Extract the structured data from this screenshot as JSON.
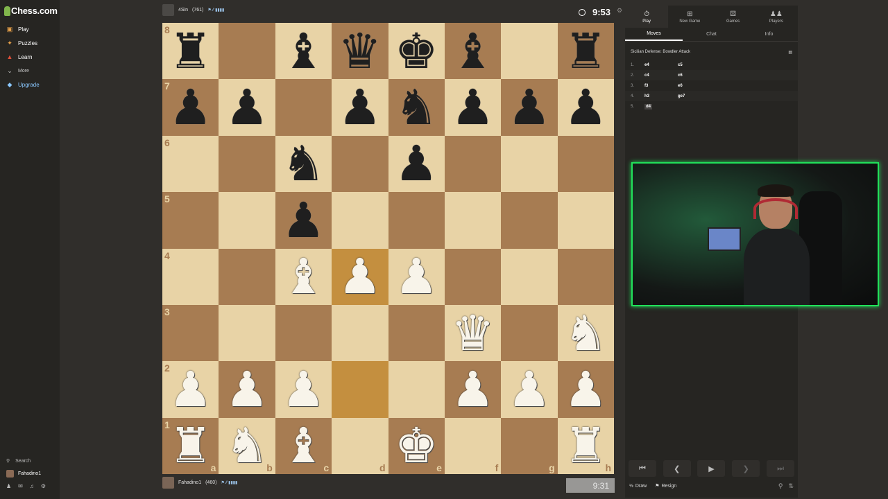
{
  "sidebar": {
    "logo_text": "Chess.com",
    "items": [
      {
        "label": "Play",
        "icon": "play-board-icon",
        "color": "#e8a24a"
      },
      {
        "label": "Puzzles",
        "icon": "puzzle-icon",
        "color": "#e8a24a"
      },
      {
        "label": "Learn",
        "icon": "learn-icon",
        "color": "#e0503a"
      },
      {
        "label": "More",
        "icon": "chevron-down-icon"
      },
      {
        "label": "Upgrade",
        "icon": "diamond-icon",
        "color": "#8ac7ff"
      }
    ],
    "search_label": "Search",
    "username": "Fahadino1"
  },
  "top_player": {
    "name": "4Sin",
    "rating": "(761)"
  },
  "bottom_player": {
    "name": "Fahadino1",
    "rating": "(460)"
  },
  "clocks": {
    "top": "9:53",
    "bottom": "9:31"
  },
  "board": {
    "ranks": [
      "8",
      "7",
      "6",
      "5",
      "4",
      "3",
      "2",
      "1"
    ],
    "files": [
      "a",
      "b",
      "c",
      "d",
      "e",
      "f",
      "g",
      "h"
    ],
    "position": [
      [
        "r",
        "",
        "b",
        "q",
        "k",
        "b",
        "",
        "r"
      ],
      [
        "p",
        "p",
        "",
        "p",
        "n",
        "p",
        "p",
        "p"
      ],
      [
        "",
        "",
        "n",
        "",
        "p",
        "",
        "",
        ""
      ],
      [
        "",
        "",
        "p",
        "",
        "",
        "",
        "",
        ""
      ],
      [
        "",
        "",
        "B",
        "P",
        "P",
        "",
        "",
        ""
      ],
      [
        "",
        "",
        "",
        "",
        "",
        "Q",
        "",
        "N"
      ],
      [
        "P",
        "P",
        "P",
        "",
        "",
        "P",
        "P",
        "P"
      ],
      [
        "R",
        "N",
        "B",
        "",
        "K",
        "",
        "",
        "R"
      ]
    ],
    "highlight": [
      "d4",
      "d2"
    ]
  },
  "panel": {
    "tabs": [
      {
        "label": "Play",
        "icon": "stopwatch-icon"
      },
      {
        "label": "New Game",
        "icon": "plus-icon"
      },
      {
        "label": "Games",
        "icon": "dice-icon"
      },
      {
        "label": "Players",
        "icon": "players-icon"
      }
    ],
    "subtabs": [
      "Moves",
      "Chat",
      "Info"
    ],
    "opening": "Sicilian Defense: Bowdler Attack",
    "moves": [
      {
        "num": "1.",
        "white": "e4",
        "black": "c5"
      },
      {
        "num": "2.",
        "white": "c4",
        "black": "c6"
      },
      {
        "num": "3.",
        "white": "f3",
        "black": "e6"
      },
      {
        "num": "4.",
        "white": "h3",
        "black": "ge7"
      },
      {
        "num": "5.",
        "white": "d4",
        "black": ""
      }
    ],
    "draw_label": "Draw",
    "resign_label": "Resign"
  }
}
